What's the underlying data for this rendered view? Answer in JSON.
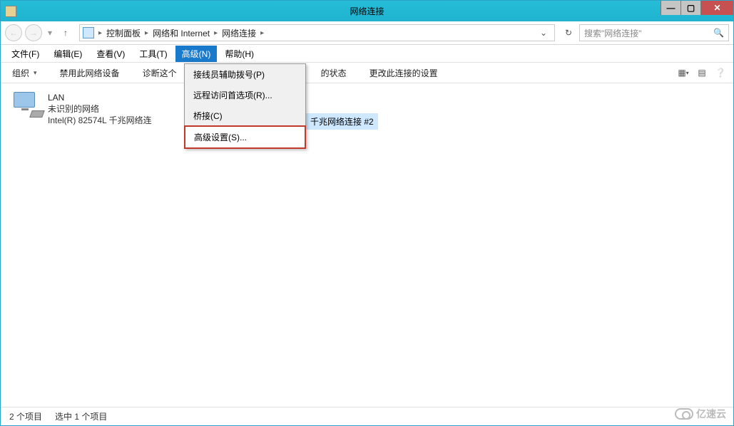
{
  "titlebar": {
    "title": "网络连接"
  },
  "breadcrumb": {
    "seg1": "控制面板",
    "seg2": "网络和 Internet",
    "seg3": "网络连接"
  },
  "search": {
    "placeholder": "搜索\"网络连接\""
  },
  "menubar": {
    "file": "文件(F)",
    "edit": "编辑(E)",
    "view": "查看(V)",
    "tools": "工具(T)",
    "advanced": "高级(N)",
    "help": "帮助(H)"
  },
  "toolbar": {
    "organize": "组织",
    "disable": "禁用此网络设备",
    "diagnose": "诊断这个",
    "status_fragment": "的状态",
    "change": "更改此连接的设置"
  },
  "dropdown": {
    "items": [
      "接线员辅助拨号(P)",
      "远程访问首选项(R)...",
      "桥接(C)",
      "高级设置(S)..."
    ]
  },
  "connections": {
    "lan": {
      "title": "LAN",
      "line1": "未识别的网络",
      "line2": "Intel(R) 82574L 千兆网络连"
    },
    "eth_fragment": "千兆网络连接 #2"
  },
  "statusbar": {
    "count": "2 个项目",
    "selected": "选中 1 个项目"
  },
  "watermark": "亿速云"
}
